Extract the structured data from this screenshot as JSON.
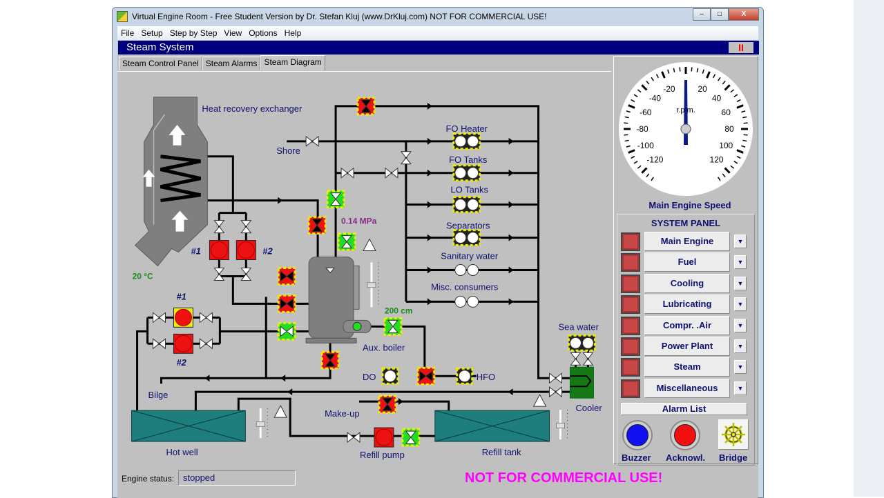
{
  "window": {
    "title": "Virtual Engine Room - Free Student Version by Dr. Stefan Kluj (www.DrKluj.com)  NOT FOR COMMERCIAL USE!",
    "minimize": "–",
    "maximize": "□",
    "close": "X"
  },
  "menu": [
    "File",
    "Setup",
    "Step by Step",
    "View",
    "Options",
    "Help"
  ],
  "header": {
    "title": "Steam System",
    "pause": "II"
  },
  "tabs": [
    {
      "label": "Steam Control Panel"
    },
    {
      "label": "Steam Alarms"
    },
    {
      "label": "Steam Diagram",
      "selected": true
    }
  ],
  "diagram": {
    "heat_recovery": "Heat recovery exchanger",
    "shore": "Shore",
    "temp": "20 °C",
    "pump1": "#1",
    "pump2": "#2",
    "feed1": "#1",
    "feed2": "#2",
    "pressure": "0.14 MPa",
    "level": "200 cm",
    "aux_boiler": "Aux. boiler",
    "consumers": [
      "FO Heater",
      "FO Tanks",
      "LO Tanks",
      "Separators",
      "Sanitary water",
      "Misc. consumers"
    ],
    "do": "DO",
    "hfo": "HFO",
    "sea_water": "Sea water",
    "cooler": "Cooler",
    "bilge": "Bilge",
    "makeup": "Make-up",
    "hot_well": "Hot well",
    "refill_pump": "Refill pump",
    "refill_tank": "Refill tank"
  },
  "gauge": {
    "title": "Main Engine Speed",
    "unit": "r.p.m.",
    "min": -120,
    "max": 120,
    "value": 0,
    "ticks": [
      "-120",
      "-100",
      "-80",
      "-60",
      "-40",
      "-20",
      "20",
      "40",
      "60",
      "80",
      "100",
      "120"
    ]
  },
  "system_panel": {
    "title": "SYSTEM PANEL",
    "items": [
      "Main Engine",
      "Fuel",
      "Cooling",
      "Lubricating",
      "Compr. .Air",
      "Power Plant",
      "Steam",
      "Miscellaneous"
    ],
    "alarm_list": "Alarm List",
    "buzzer": "Buzzer",
    "acknowledge": "Acknowl.",
    "bridge": "Bridge"
  },
  "status": {
    "label": "Engine status:",
    "value": "stopped",
    "notice": "NOT FOR COMMERCIAL USE!"
  },
  "colors": {
    "valve_open": "#22dd22",
    "valve_closed": "#ee1111",
    "pump": "#ee1111",
    "tank": "#1e7d7d",
    "cooler": "#157a15",
    "header": "#00007e",
    "notice": "#ff00ff"
  }
}
